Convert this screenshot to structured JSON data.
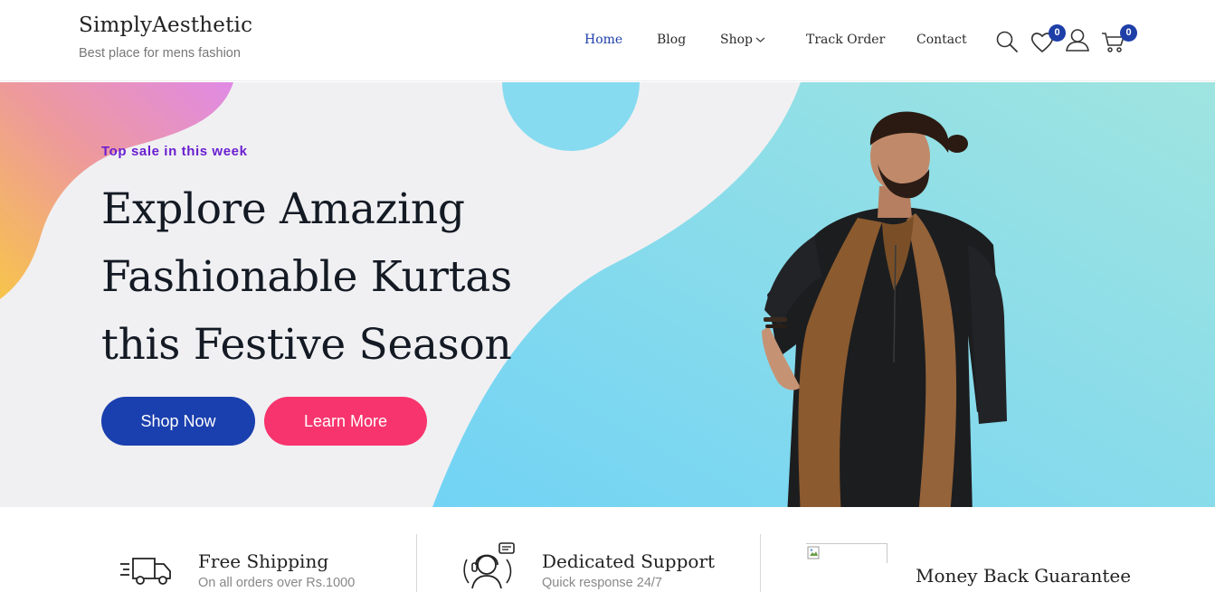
{
  "header": {
    "brand_name": "SimplyAesthetic",
    "brand_tagline": "Best place for mens fashion",
    "nav": {
      "home": "Home",
      "blog": "Blog",
      "shop": "Shop",
      "track_order": "Track Order",
      "contact": "Contact"
    },
    "active_nav": "Home",
    "wishlist_count": "0",
    "cart_count": "0",
    "icons": [
      "search-icon",
      "heart-icon",
      "user-icon",
      "cart-icon",
      "chevron-down-icon"
    ]
  },
  "hero": {
    "kicker": "Top sale in this week",
    "title_line1": "Explore Amazing",
    "title_line2": "Fashionable Kurtas",
    "title_line3": "this Festive Season",
    "primary_button": "Shop Now",
    "secondary_button": "Learn More"
  },
  "features": [
    {
      "title": "Free Shipping",
      "subtitle": "On all orders over Rs.1000",
      "icon": "truck-icon"
    },
    {
      "title": "Dedicated Support",
      "subtitle": "Quick response 24/7",
      "icon": "support-agent-icon"
    },
    {
      "title": "Money Back Guarantee",
      "subtitle": "",
      "icon": "broken-image-icon"
    }
  ],
  "colors": {
    "brand_blue": "#1a3fae",
    "accent_pink": "#f7346d",
    "kicker_purple": "#6a1fd0",
    "hero_cyan": "#7fd9ef"
  }
}
